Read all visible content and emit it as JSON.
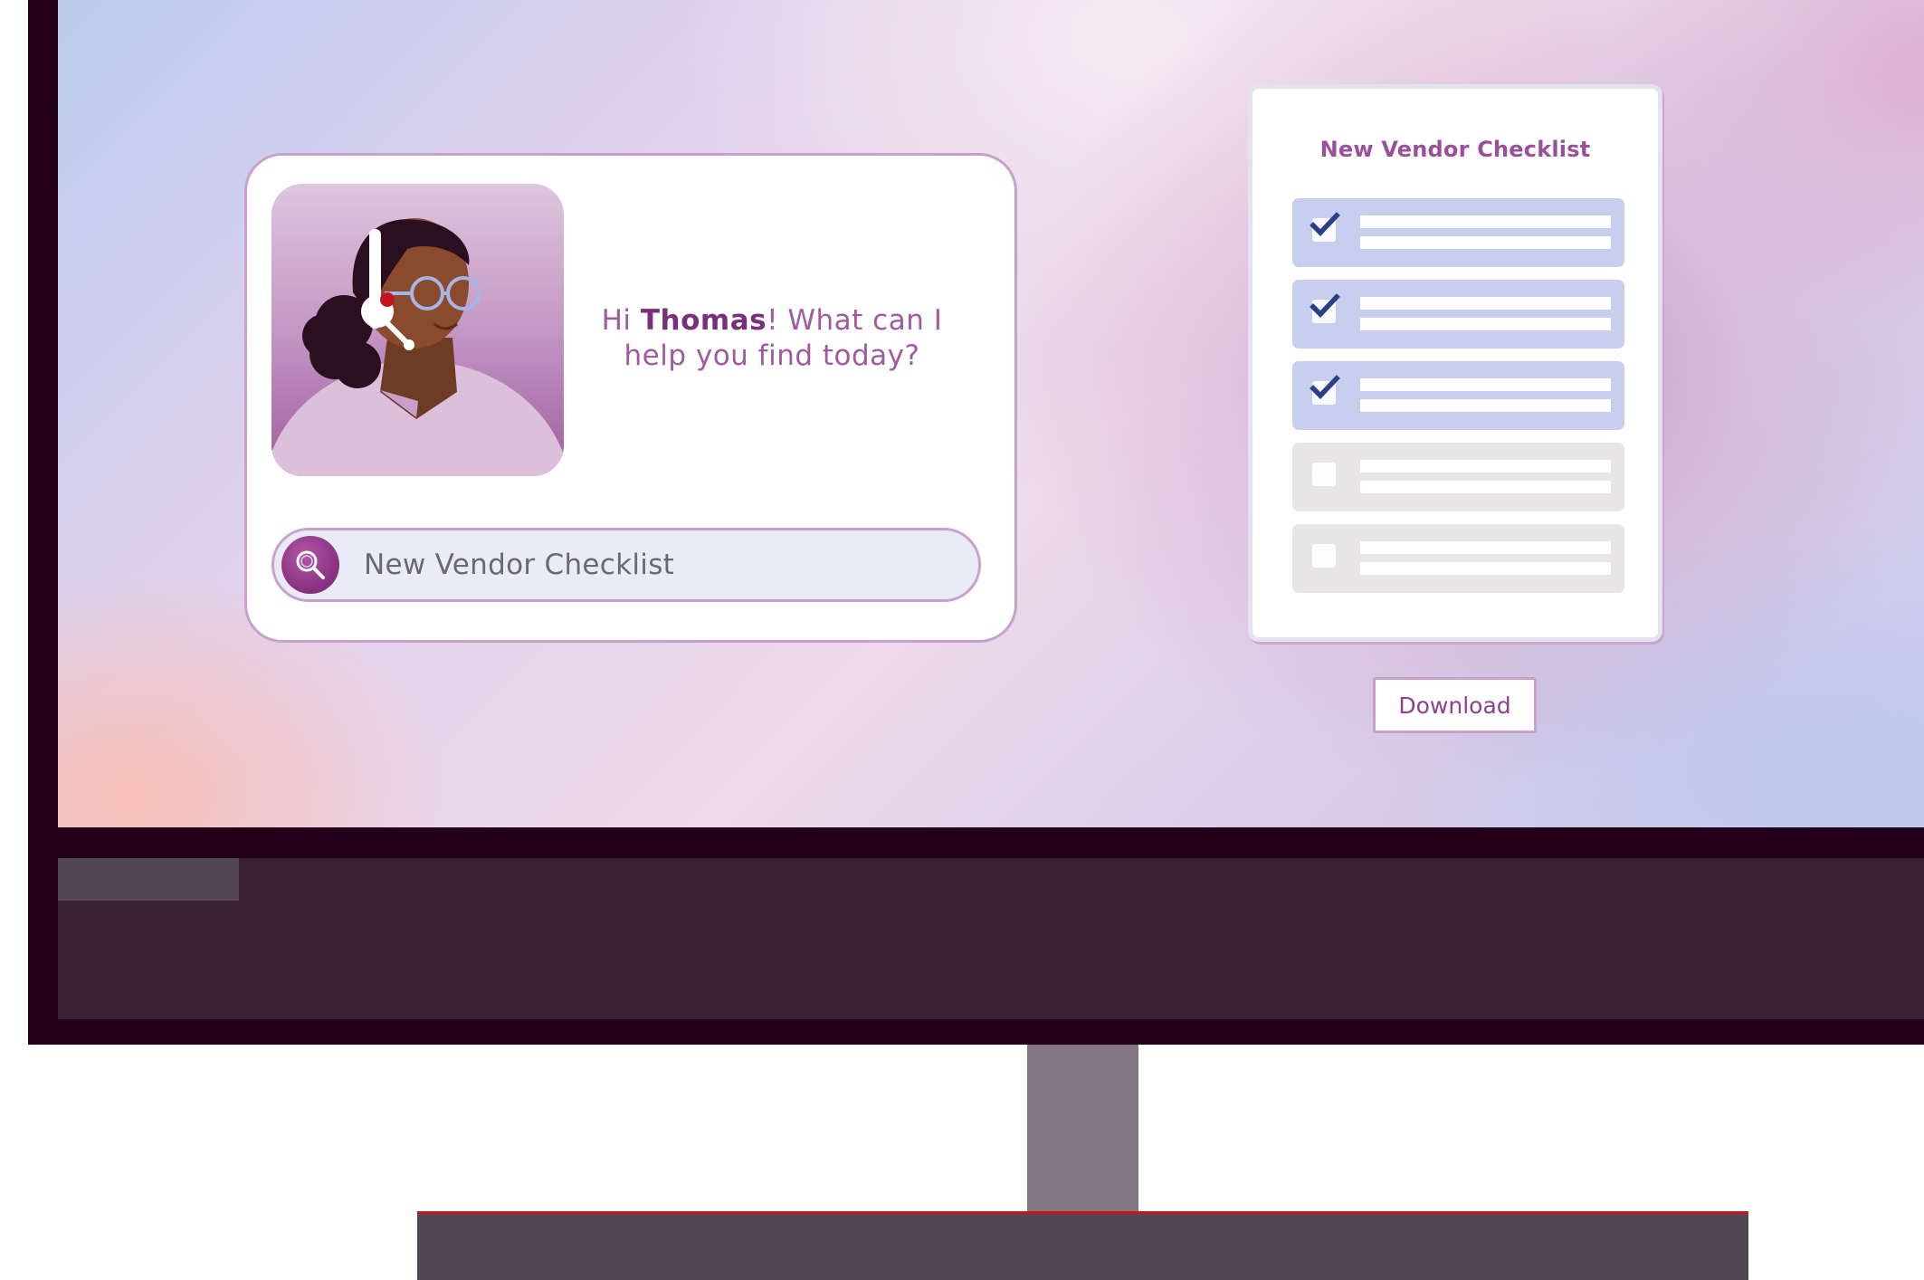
{
  "chat": {
    "greeting_prefix": "Hi ",
    "user_name": "Thomas",
    "greeting_suffix": "! What can I help you find today?",
    "avatar_icon": "support-agent-avatar",
    "search_icon": "search-icon",
    "search_value": "New Vendor Checklist"
  },
  "checklist": {
    "title": "New Vendor Checklist",
    "items": [
      {
        "checked": true
      },
      {
        "checked": true
      },
      {
        "checked": true
      },
      {
        "checked": false
      },
      {
        "checked": false
      }
    ],
    "download_label": "Download"
  },
  "colors": {
    "accent": "#8e3f8d",
    "checked_row": "#c8ceee",
    "unchecked_row": "#e8e5e6",
    "checkmark": "#2b3f86",
    "monitor_bezel": "#23011a",
    "taskbar": "#3a2033"
  }
}
